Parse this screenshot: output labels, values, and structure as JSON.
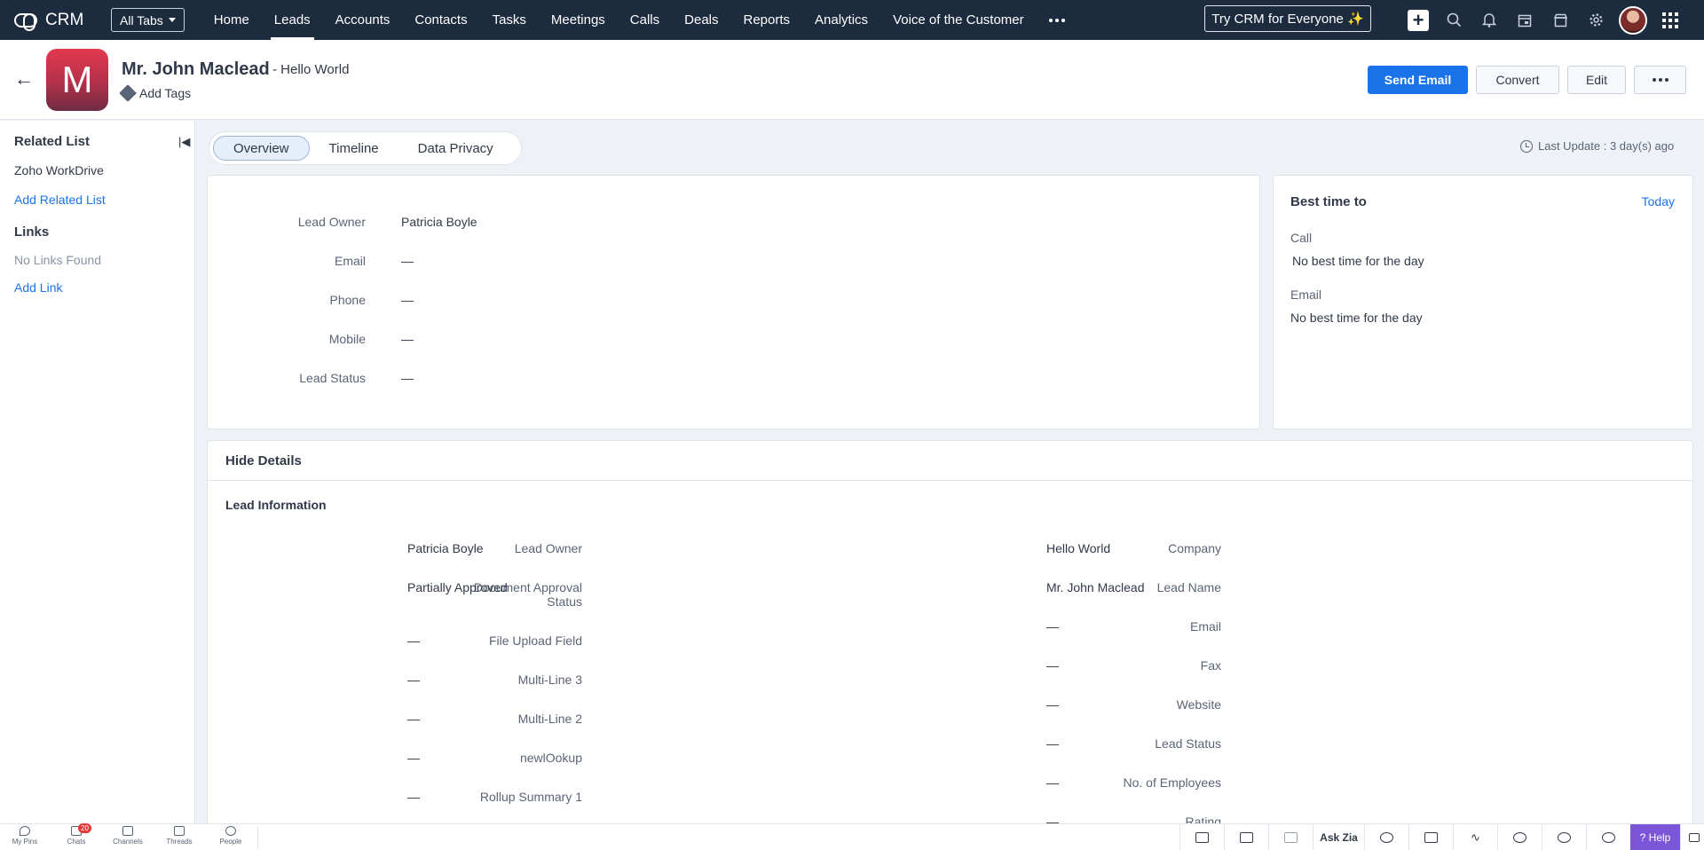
{
  "app": {
    "name": "CRM",
    "all_tabs": "All Tabs",
    "try_button": "Try CRM for Everyone ✨"
  },
  "nav": [
    {
      "label": "Home",
      "active": false
    },
    {
      "label": "Leads",
      "active": true
    },
    {
      "label": "Accounts",
      "active": false
    },
    {
      "label": "Contacts",
      "active": false
    },
    {
      "label": "Tasks",
      "active": false
    },
    {
      "label": "Meetings",
      "active": false
    },
    {
      "label": "Calls",
      "active": false
    },
    {
      "label": "Deals",
      "active": false
    },
    {
      "label": "Reports",
      "active": false
    },
    {
      "label": "Analytics",
      "active": false
    },
    {
      "label": "Voice of the Customer",
      "active": false
    }
  ],
  "record": {
    "avatar_letter": "M",
    "name": "Mr. John Maclead",
    "company_suffix": "- Hello World",
    "add_tags": "Add Tags",
    "buttons": {
      "send_email": "Send Email",
      "convert": "Convert",
      "edit": "Edit"
    }
  },
  "sidebar": {
    "related_title": "Related List",
    "related_item": "Zoho WorkDrive",
    "add_related": "Add Related List",
    "links_title": "Links",
    "no_links": "No Links Found",
    "add_link": "Add Link"
  },
  "tabs": [
    "Overview",
    "Timeline",
    "Data Privacy"
  ],
  "last_update": "Last Update : 3 day(s) ago",
  "overview_fields": [
    {
      "label": "Lead Owner",
      "value": "Patricia Boyle"
    },
    {
      "label": "Email",
      "value": "—"
    },
    {
      "label": "Phone",
      "value": "—"
    },
    {
      "label": "Mobile",
      "value": "—"
    },
    {
      "label": "Lead Status",
      "value": "—"
    }
  ],
  "best_time": {
    "title": "Best time to",
    "today": "Today",
    "call_label": "Call",
    "call_value": "No best time for the day",
    "email_label": "Email",
    "email_value": "No best time for the day"
  },
  "details": {
    "hide_details": "Hide Details",
    "section_title": "Lead Information",
    "left": [
      {
        "label": "Lead Owner",
        "value": "Patricia Boyle"
      },
      {
        "label": "Document Approval Status",
        "value": "Partially Approved"
      },
      {
        "label": "File Upload Field",
        "value": "—"
      },
      {
        "label": "Multi-Line 3",
        "value": "—"
      },
      {
        "label": "Multi-Line 2",
        "value": "—"
      },
      {
        "label": "newlOokup",
        "value": "—"
      },
      {
        "label": "Rollup Summary 1",
        "value": "—"
      }
    ],
    "right": [
      {
        "label": "Company",
        "value": "Hello World"
      },
      {
        "label": "Lead Name",
        "value": "Mr. John Maclead"
      },
      {
        "label": "Email",
        "value": "—"
      },
      {
        "label": "Fax",
        "value": "—"
      },
      {
        "label": "Website",
        "value": "—"
      },
      {
        "label": "Lead Status",
        "value": "—"
      },
      {
        "label": "No. of Employees",
        "value": "—"
      },
      {
        "label": "Rating",
        "value": "—"
      }
    ]
  },
  "bottom": {
    "items": [
      "My Pins",
      "Chats",
      "Channels",
      "Threads",
      "People"
    ],
    "chat_badge": "20",
    "ask_zia": "Ask Zia",
    "help": "Help"
  }
}
